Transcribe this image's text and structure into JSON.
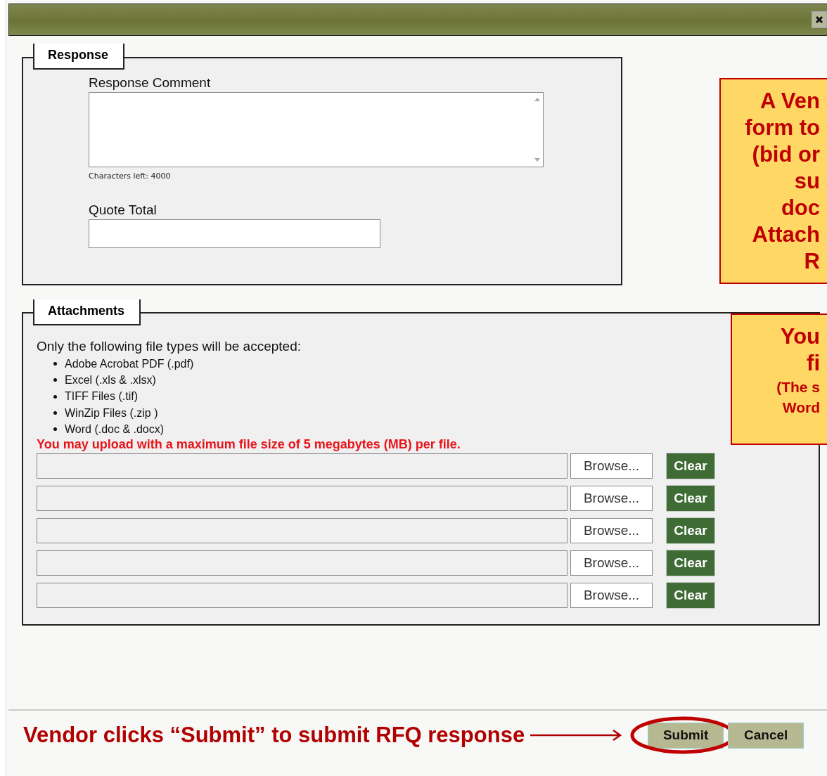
{
  "response": {
    "legend": "Response",
    "comment_label": "Response Comment",
    "chars_left": "Characters left: 4000",
    "quote_label": "Quote Total"
  },
  "attachments": {
    "legend": "Attachments",
    "intro": "Only the following file types will be accepted:",
    "file_types": [
      "Adobe Acrobat PDF (.pdf)",
      "Excel (.xls & .xlsx)",
      "TIFF Files (.tif)",
      "WinZip Files (.zip )",
      "Word (.doc & .docx)"
    ],
    "limit_note": "You may upload with a maximum file size of 5 megabytes (MB) per file.",
    "rows": [
      {
        "browse": "Browse...",
        "clear": "Clear"
      },
      {
        "browse": "Browse...",
        "clear": "Clear"
      },
      {
        "browse": "Browse...",
        "clear": "Clear"
      },
      {
        "browse": "Browse...",
        "clear": "Clear"
      },
      {
        "browse": "Browse...",
        "clear": "Clear"
      }
    ]
  },
  "buttons": [
    {
      "label": "Submit",
      "circled": true
    },
    {
      "label": "Cancel",
      "circled": false
    }
  ],
  "callouts": [
    {
      "lines": [
        {
          "text": "A Ven",
          "kind": "large"
        },
        {
          "text": "form to",
          "kind": "large"
        },
        {
          "text": "(bid or",
          "kind": "large"
        },
        {
          "text": "su",
          "kind": "large"
        },
        {
          "text": "doc",
          "kind": "large"
        },
        {
          "text": "Attach",
          "kind": "large"
        },
        {
          "text": "R",
          "kind": "large"
        }
      ]
    },
    {
      "lines": [
        {
          "text": "You",
          "kind": "large"
        },
        {
          "text": "fi",
          "kind": "large"
        },
        {
          "text": "(The s",
          "kind": "small"
        },
        {
          "text": "Word",
          "kind": "small"
        }
      ]
    }
  ],
  "pointer_note": "Vendor clicks “Submit” to submit RFQ response"
}
